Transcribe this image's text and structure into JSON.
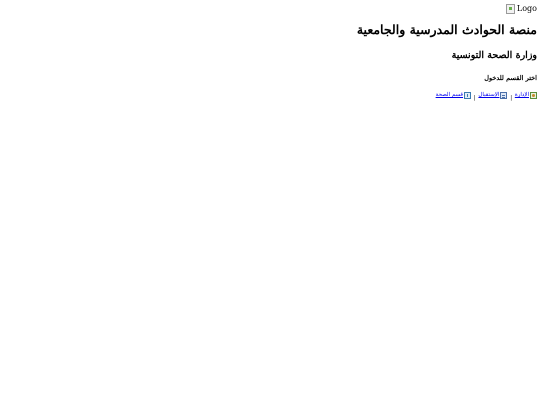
{
  "logo": {
    "alt": "Logo"
  },
  "header": {
    "title": "منصة الحوادث المدرسية والجامعية",
    "ministry": "وزارة الصحة التونسية",
    "prompt": "اختر القسم للدخول"
  },
  "nav": {
    "separator": "|",
    "links": [
      {
        "label": "الإدارة",
        "icon": "admin-icon"
      },
      {
        "label": "الإستقبال",
        "icon": "reception-icon"
      },
      {
        "label": "قسم الصحة",
        "icon": "health-icon"
      }
    ]
  }
}
